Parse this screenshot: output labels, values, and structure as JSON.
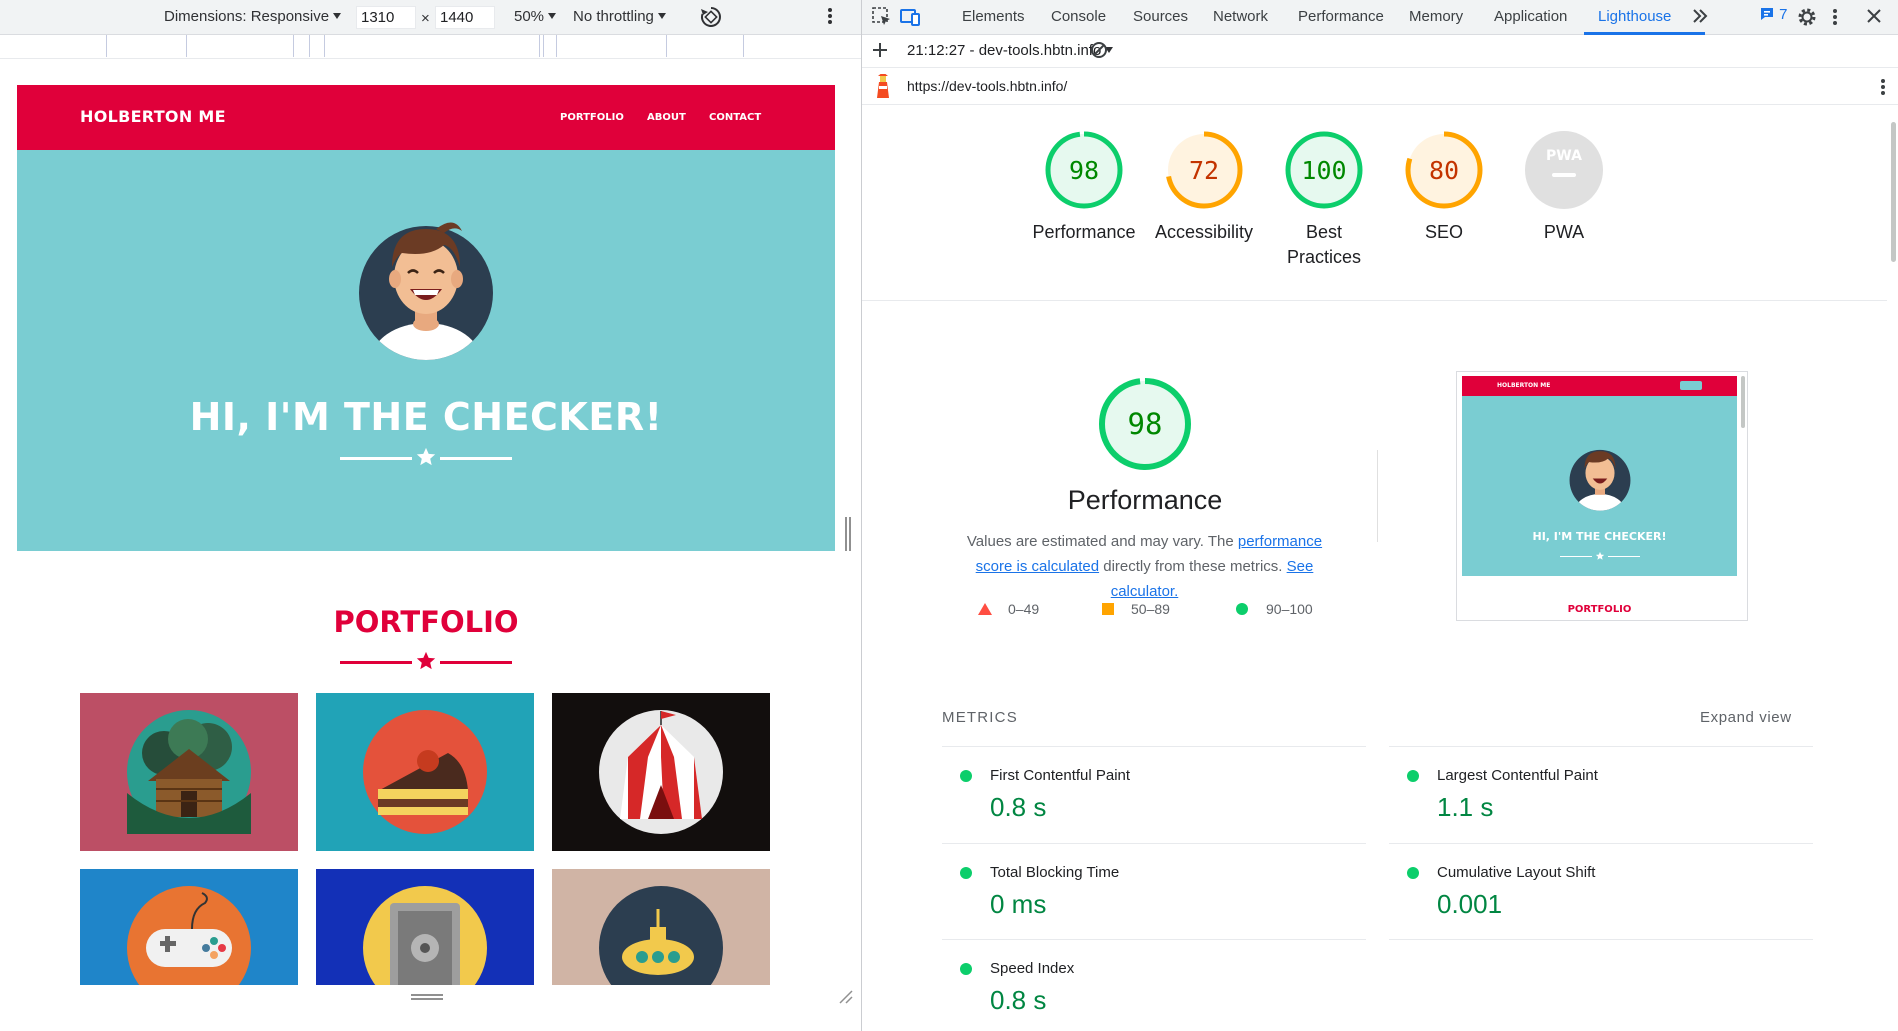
{
  "device_toolbar": {
    "dimensions_label": "Dimensions: Responsive",
    "width": "1310",
    "height": "1440",
    "times": "×",
    "zoom": "50%",
    "throttling": "No throttling"
  },
  "emulated_page": {
    "brand": "HOLBERTON ME",
    "nav": [
      "PORTFOLIO",
      "ABOUT",
      "CONTACT"
    ],
    "hero_title": "HI, I'M THE CHECKER!",
    "section_title": "PORTFOLIO",
    "colors": {
      "header": "#e0003a",
      "hero": "#7acdd2"
    },
    "tiles": [
      {
        "icon": "cabin-icon",
        "bg": "#bc4f65"
      },
      {
        "icon": "cake-icon",
        "bg": "#21a3b7"
      },
      {
        "icon": "circus-tent-icon",
        "bg": "#120e0d"
      },
      {
        "icon": "gamepad-icon",
        "bg": "#1f85c9"
      },
      {
        "icon": "safe-icon",
        "bg": "#1330b7"
      },
      {
        "icon": "submarine-icon",
        "bg": "#d0b4a5"
      }
    ]
  },
  "devtools": {
    "tabs": [
      "Elements",
      "Console",
      "Sources",
      "Network",
      "Performance",
      "Memory",
      "Application",
      "Lighthouse"
    ],
    "active_tab": "Lighthouse",
    "issues_count": "7",
    "report_label": "21:12:27 - dev-tools.hbtn.info",
    "url": "https://dev-tools.hbtn.info/",
    "scores": [
      {
        "label": "Performance",
        "value": "98",
        "score": 98,
        "status": "pass"
      },
      {
        "label": "Accessibility",
        "value": "72",
        "score": 72,
        "status": "average"
      },
      {
        "label": "Best Practices",
        "value": "100",
        "score": 100,
        "status": "pass"
      },
      {
        "label": "SEO",
        "value": "80",
        "score": 80,
        "status": "average"
      },
      {
        "label": "PWA",
        "value": "PWA",
        "score": 0,
        "status": "na"
      }
    ],
    "performance": {
      "score": "98",
      "score_value": 98,
      "title": "Performance",
      "desc_prefix": "Values are estimated and may vary. The ",
      "link1": "performance score is calculated",
      "desc_mid": " directly from these metrics. ",
      "link2": "See calculator."
    },
    "legend": [
      "0–49",
      "50–89",
      "90–100"
    ],
    "thumbnail": {
      "brand": "HOLBERTON ME",
      "title": "HI, I'M THE CHECKER!",
      "section": "PORTFOLIO"
    },
    "metrics_heading": "METRICS",
    "expand_label": "Expand view",
    "metrics": [
      {
        "name": "First Contentful Paint",
        "value": "0.8 s"
      },
      {
        "name": "Largest Contentful Paint",
        "value": "1.1 s"
      },
      {
        "name": "Total Blocking Time",
        "value": "0 ms"
      },
      {
        "name": "Cumulative Layout Shift",
        "value": "0.001"
      },
      {
        "name": "Speed Index",
        "value": "0.8 s"
      }
    ],
    "colors": {
      "pass": "#0cce6b",
      "pass_text": "#008800",
      "average": "#ffa400",
      "average_text": "#c33300",
      "na": "#e0e0e0",
      "fail": "#ff4e42",
      "accent": "#1a73e8"
    }
  }
}
